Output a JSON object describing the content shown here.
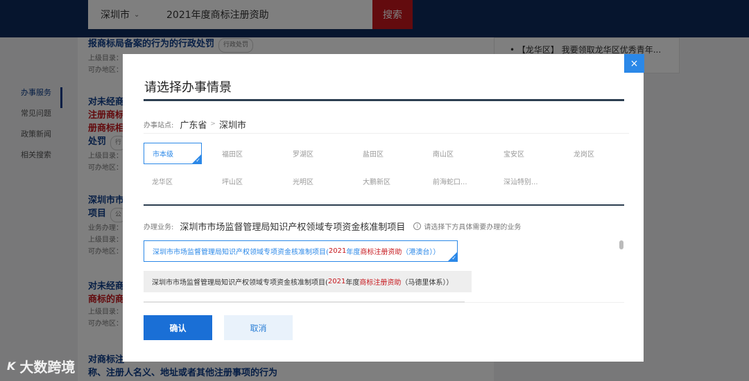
{
  "header": {
    "city": "深圳市",
    "search_value": "2021年度商标注册资助",
    "search_button": "搜索"
  },
  "sidebar": {
    "items": [
      {
        "label": "办事服务",
        "active": true
      },
      {
        "label": "常见问题"
      },
      {
        "label": "政策新闻"
      },
      {
        "label": "相关搜索"
      }
    ]
  },
  "background_results": [
    {
      "title_a": "报商标局备案的行为的行政处罚",
      "tag": "行政处罚",
      "meta1": "上级目录：",
      "meta2": "可办地区："
    },
    {
      "title_a": "对未经商",
      "title_b": "注册商标",
      "title_c": "册商标相",
      "title_d": "处罚",
      "tag": "行",
      "meta1": "上级目录：",
      "meta2": "可办地区："
    },
    {
      "title_a": "深圳市市",
      "title_b": "项目",
      "tag": "公",
      "meta0": "业务办理：",
      "meta1": "上级目录：",
      "meta2": "可办地区："
    },
    {
      "title_a": "对未经商",
      "title_b": "商标的商",
      "meta1": "上级目录：",
      "meta2": "可办地区："
    },
    {
      "title_a": "对商标注",
      "title_b": "称、注册人名义、地址或者其他注册事项的行为",
      "title_b_red": "注册"
    }
  ],
  "right_card": {
    "text": "【龙华区】 我要领取龙华区优秀青年..."
  },
  "watermark": {
    "logo": "K",
    "text": "大数跨境"
  },
  "modal": {
    "close": "×",
    "title": "请选择办事情景",
    "site_label": "办事站点:",
    "province": "广东省",
    "separator": ">",
    "city": "深圳市",
    "districts": [
      "市本级",
      "福田区",
      "罗湖区",
      "盐田区",
      "南山区",
      "宝安区",
      "龙岗区",
      "龙华区",
      "坪山区",
      "光明区",
      "大鹏新区",
      "前海蛇口...",
      "深汕特别..."
    ],
    "selected_district": "市本级",
    "business_label": "办理业务:",
    "business_value": "深圳市市场监督管理局知识产权领域专项资金核准制项目",
    "hint": "请选择下方具体需要办理的业务",
    "options": [
      {
        "prefix": "深圳市市场监督管理局知识产权领域专项资金核准制项目(",
        "year": "2021",
        "mid": "年度",
        "red": "商标注册资助",
        "suffix": "（港澳台））",
        "selected": true
      },
      {
        "prefix": "深圳市市场监督管理局知识产权领域专项资金核准制项目(",
        "year": "2021",
        "mid": "年度",
        "red": "商标注册资助",
        "suffix": "（马德里体系））",
        "selected": false
      }
    ],
    "confirm": "确认",
    "cancel": "取消"
  },
  "colors": {
    "header_bg": "#0d2b5c",
    "accent": "#2b88e8",
    "brand_red": "#c6171c",
    "confirm_bg": "#1a6fd6"
  }
}
